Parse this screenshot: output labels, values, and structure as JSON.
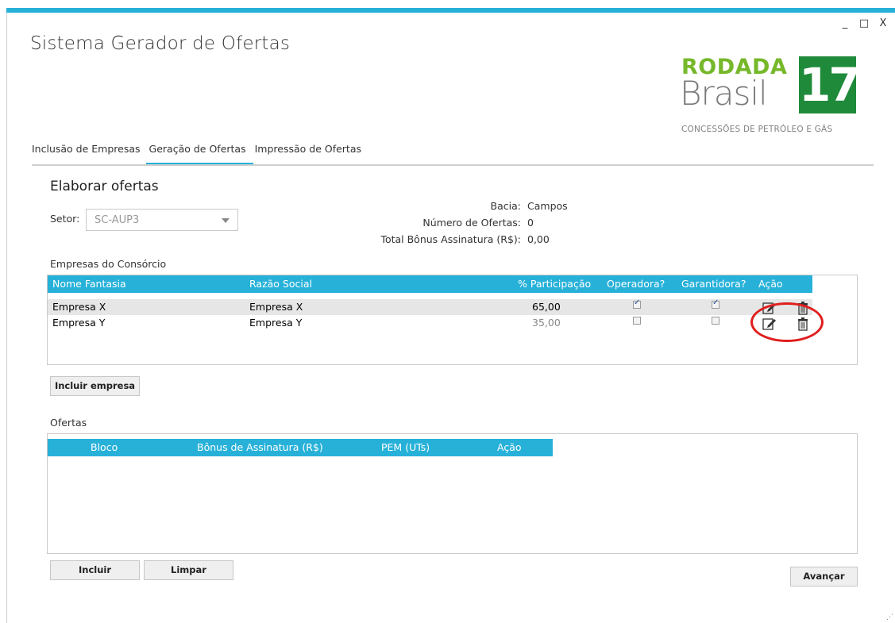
{
  "window": {
    "title": "Sistema Gerador de Ofertas",
    "controls": {
      "minimize": "_",
      "maximize": "□",
      "close": "X"
    }
  },
  "logo": {
    "line1": "RODADA",
    "line2": "Brasil",
    "number": "17",
    "subtitle": "CONCESSÕES DE PETRÓLEO E GÁS",
    "colors": {
      "green": "#76b82a",
      "dark_green": "#1f8a3a",
      "gray": "#7a7a7a"
    }
  },
  "tabs": [
    {
      "label": "Inclusão de Empresas",
      "active": false
    },
    {
      "label": "Geração de Ofertas",
      "active": true
    },
    {
      "label": "Impressão de Ofertas",
      "active": false
    }
  ],
  "form": {
    "section_title": "Elaborar ofertas",
    "setor_label": "Setor:",
    "setor_value": "SC-AUP3",
    "bacia_label": "Bacia:",
    "bacia_value": "Campos",
    "num_ofertas_label": "Número de Ofertas:",
    "num_ofertas_value": "0",
    "total_bonus_label": "Total Bônus Assinatura (R$):",
    "total_bonus_value": "0,00"
  },
  "consorcio": {
    "label": "Empresas do Consórcio",
    "columns": [
      "Nome Fantasia",
      "Razão Social",
      "% Participação",
      "Operadora?",
      "Garantidora?",
      "Ação"
    ],
    "rows": [
      {
        "nome": "Empresa X",
        "razao": "Empresa X",
        "participacao": "65,00",
        "operadora": true,
        "garantidora": true
      },
      {
        "nome": "Empresa Y",
        "razao": "Empresa Y",
        "participacao": "35,00",
        "operadora": false,
        "garantidora": false
      }
    ],
    "add_button": "Incluir empresa"
  },
  "ofertas": {
    "label": "Ofertas",
    "columns": [
      "Bloco",
      "Bônus de Assinatura (R$)",
      "PEM (UTs)",
      "Ação"
    ]
  },
  "buttons": {
    "incluir": "Incluir",
    "limpar": "Limpar",
    "avancar": "Avançar"
  },
  "accent_color": "#27b1d9",
  "annotation_color": "#e01e1e"
}
